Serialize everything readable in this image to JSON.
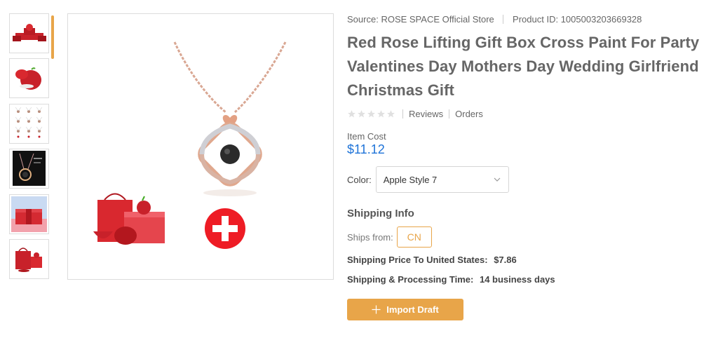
{
  "product": {
    "source_label": "Source:",
    "source_store": "ROSE SPACE Official Store",
    "product_id_label": "Product ID:",
    "product_id": "1005003203669328",
    "title": "Red Rose Lifting Gift Box Cross Paint For Party Valentines Day Mothers Day Wedding Girlfriend Christmas Gift",
    "rating_stars": 0,
    "reviews_label": "Reviews",
    "orders_label": "Orders",
    "item_cost_label": "Item Cost",
    "item_cost": "$11.12",
    "color_label": "Color:",
    "color_selected": "Apple Style 7"
  },
  "shipping": {
    "title": "Shipping Info",
    "ships_from_label": "Ships from:",
    "ships_from": "CN",
    "price_label": "Shipping Price To United States:",
    "price": "$7.86",
    "time_label": "Shipping & Processing Time:",
    "time": "14 business days"
  },
  "actions": {
    "import_label": "Import Draft"
  },
  "icons": {
    "star": "star-icon",
    "chevron": "chevron-down-icon",
    "plus": "plus-icon"
  },
  "colors": {
    "accent": "#e8a549",
    "price": "#1e73d8",
    "gift_red": "#d9282f"
  },
  "thumbnails": [
    {
      "name": "gift-box-open"
    },
    {
      "name": "red-apple"
    },
    {
      "name": "necklace-variants-grid"
    },
    {
      "name": "necklace-dark"
    },
    {
      "name": "gift-box-pink"
    },
    {
      "name": "gift-bag-set"
    }
  ]
}
